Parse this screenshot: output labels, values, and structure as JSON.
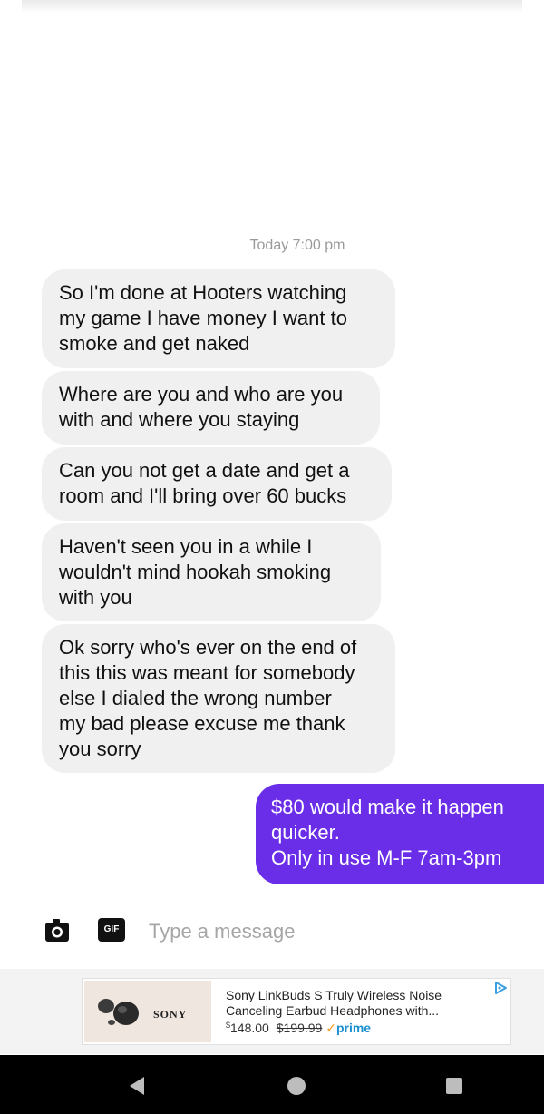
{
  "conversation": {
    "timestamp": "Today 7:00 pm",
    "incoming": [
      [
        "So I'm done at Hooters watching",
        "my game I have money I want to",
        "smoke and get naked"
      ],
      [
        "Where are you and who are you",
        "with and where you staying"
      ],
      [
        "Can you not get a date and get a",
        "room and I'll bring over 60 bucks"
      ],
      [
        "Haven't seen you in a while I",
        "wouldn't mind hookah smoking",
        "with you"
      ],
      [
        "Ok sorry who's ever on the end of",
        "this this was meant for somebody",
        "else I dialed the wrong number",
        "my bad please excuse me thank",
        "you sorry"
      ]
    ],
    "outgoing": {
      "line1": "$80 would make it happen",
      "line2": "quicker.",
      "line3": "Only in use M-F 7am-3pm"
    }
  },
  "composer": {
    "camera_icon": "camera-icon",
    "gif_label": "GIF",
    "placeholder": "Type a message"
  },
  "ad": {
    "brand": "SONY",
    "title": "Sony LinkBuds S Truly Wireless Noise Canceling Earbud Headphones with...",
    "price_symbol": "$",
    "price": "148.00",
    "list_price": "$199.99",
    "prime_check": "✓",
    "prime_label": "prime",
    "adchoices_icon": "adchoices-icon"
  },
  "navbar": {
    "back_icon": "back-triangle-icon",
    "home_icon": "home-circle-icon",
    "recents_icon": "recents-square-icon"
  },
  "colors": {
    "outgoing_bubble": "#6a2ee8",
    "incoming_bubble": "#f0f0f0",
    "navbar": "#000000"
  }
}
